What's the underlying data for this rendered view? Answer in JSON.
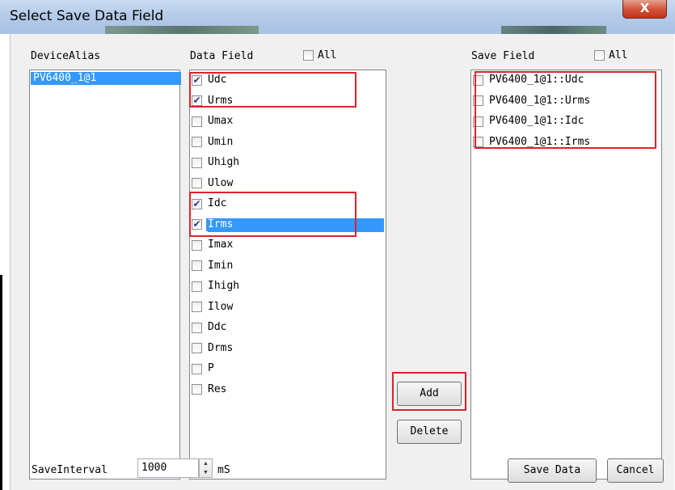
{
  "window": {
    "title": "Select Save Data Field",
    "close_glyph": "X"
  },
  "device_list": {
    "header": "DeviceAlias",
    "items": [
      "PV6400_1@1"
    ]
  },
  "data_field": {
    "header": "Data Field",
    "all_label": "All",
    "all_checked": false,
    "items": [
      {
        "label": "Udc",
        "checked": true
      },
      {
        "label": "Urms",
        "checked": true
      },
      {
        "label": "Umax",
        "checked": false
      },
      {
        "label": "Umin",
        "checked": false
      },
      {
        "label": "Uhigh",
        "checked": false
      },
      {
        "label": "Ulow",
        "checked": false
      },
      {
        "label": "Idc",
        "checked": true
      },
      {
        "label": "Irms",
        "checked": true,
        "selected": true
      },
      {
        "label": "Imax",
        "checked": false
      },
      {
        "label": "Imin",
        "checked": false
      },
      {
        "label": "Ihigh",
        "checked": false
      },
      {
        "label": "Ilow",
        "checked": false
      },
      {
        "label": "Ddc",
        "checked": false
      },
      {
        "label": "Drms",
        "checked": false
      },
      {
        "label": "P",
        "checked": false
      },
      {
        "label": "Res",
        "checked": false
      }
    ]
  },
  "save_field": {
    "header": "Save Field",
    "all_label": "All",
    "all_checked": false,
    "items": [
      {
        "label": "PV6400_1@1::Udc",
        "checked": false
      },
      {
        "label": "PV6400_1@1::Urms",
        "checked": false
      },
      {
        "label": "PV6400_1@1::Idc",
        "checked": false
      },
      {
        "label": "PV6400_1@1::Irms",
        "checked": false
      }
    ]
  },
  "buttons": {
    "add": "Add",
    "delete": "Delete",
    "save_data": "Save Data",
    "cancel": "Cancel"
  },
  "interval": {
    "label": "SaveInterval",
    "value": "1000",
    "unit": "mS"
  },
  "colors": {
    "selection": "#3399ff",
    "highlight_box": "#e0202a"
  },
  "icons": {
    "check": "checkmark-icon",
    "spin_up": "triangle-up-icon",
    "spin_down": "triangle-down-icon"
  }
}
